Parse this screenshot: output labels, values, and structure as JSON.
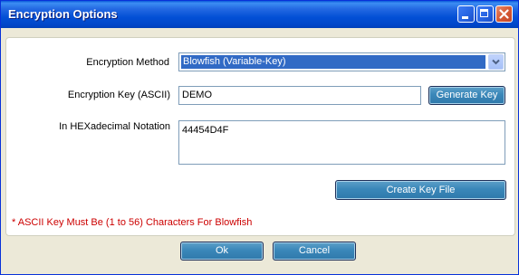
{
  "window": {
    "title": "Encryption Options",
    "titlebar_color": "#0a5ad8",
    "close_button_color": "#d65a33"
  },
  "form": {
    "method_label": "Encryption Method",
    "method_value": "Blowfish (Variable-Key)",
    "key_label": "Encryption Key (ASCII)",
    "key_value": "DEMO",
    "generate_button": "Generate Key",
    "hex_label": "In HEXadecimal Notation",
    "hex_value": "44454D4F",
    "create_button": "Create Key File",
    "note": "* ASCII Key Must Be (1 to 56) Characters For Blowfish",
    "note_color": "#cc0000"
  },
  "footer": {
    "ok_label": "Ok",
    "cancel_label": "Cancel"
  },
  "icons": {
    "minimize": "minimize-icon",
    "maximize": "maximize-icon",
    "close": "close-icon",
    "dropdown": "chevron-down-icon"
  }
}
